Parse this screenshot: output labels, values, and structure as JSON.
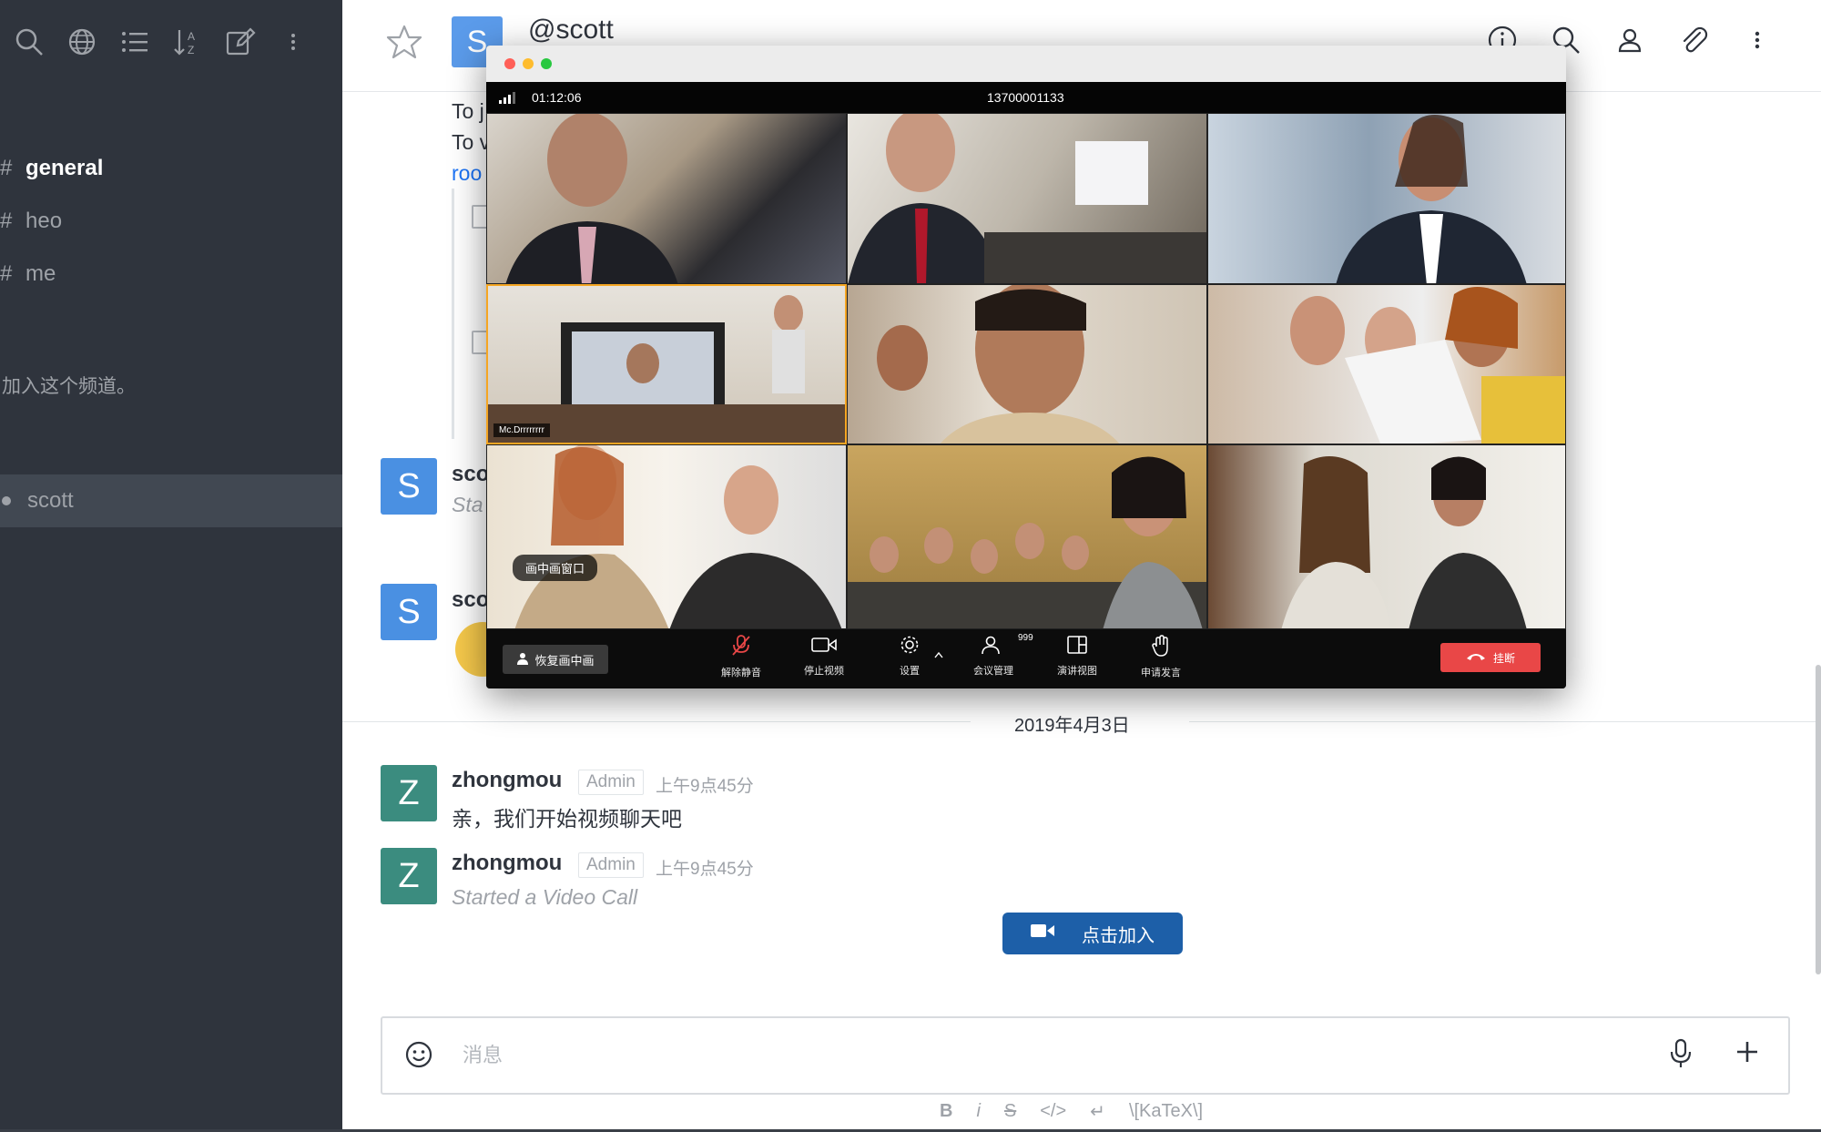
{
  "sidebar": {
    "toolbar_icons": [
      "search-icon",
      "globe-icon",
      "list-icon",
      "sort-alpha-icon",
      "edit-icon",
      "kebab-menu-icon"
    ],
    "channels": [
      {
        "prefix": "#",
        "label": "general",
        "bold": true
      },
      {
        "prefix": "#",
        "label": "heo",
        "bold": false
      },
      {
        "prefix": "#",
        "label": "me",
        "bold": false
      }
    ],
    "note": "加入这个频道。",
    "dm": {
      "label": "scott"
    }
  },
  "header": {
    "avatar_letter": "S",
    "title": "@scott",
    "icons": [
      "info-icon",
      "search-icon",
      "user-icon",
      "paperclip-icon",
      "kebab-menu-icon"
    ]
  },
  "messages_background": {
    "line1": "To j",
    "line2": "To v",
    "link": "roo",
    "msg1": {
      "avatar": "S",
      "name": "sco",
      "text": "Sta"
    },
    "msg2": {
      "avatar": "S",
      "name": "sco"
    }
  },
  "date_separator": "2019年4月3日",
  "messages": [
    {
      "avatar": "Z",
      "name": "zhongmou",
      "role": "Admin",
      "time": "上午9点45分",
      "text": "亲，我们开始视频聊天吧",
      "italic": false
    },
    {
      "avatar": "Z",
      "name": "zhongmou",
      "role": "Admin",
      "time": "上午9点45分",
      "text": "Started a Video Call",
      "italic": true
    }
  ],
  "join_button": {
    "label": "点击加入"
  },
  "composer": {
    "placeholder": "消息",
    "format_buttons": [
      "B",
      "i",
      "S",
      "</>",
      "↵",
      "\\[KaTeX\\]"
    ]
  },
  "video_call": {
    "timer": "01:12:06",
    "number": "13700001133",
    "active_tile_tag": "Mc.Drrrrrrrr",
    "pip_label": "画中画窗口",
    "restore_label": "恢复画中画",
    "controls": [
      {
        "icon": "mic-muted-icon",
        "label": "解除静音"
      },
      {
        "icon": "camera-icon",
        "label": "停止视频"
      },
      {
        "icon": "gear-icon",
        "label": "设置"
      },
      {
        "icon": "participants-icon",
        "label": "会议管理",
        "badge": "999"
      },
      {
        "icon": "layout-icon",
        "label": "演讲视图"
      },
      {
        "icon": "raise-hand-icon",
        "label": "申请发言"
      }
    ],
    "hangup_label": "挂断",
    "colors": {
      "hangup": "#e94747",
      "active_border": "#f5a623"
    }
  },
  "colors": {
    "sidebar_bg": "#2f343d",
    "join_button": "#1d5fa8",
    "avatar_s": "#4a90e2",
    "avatar_z": "#3b8c7f"
  }
}
